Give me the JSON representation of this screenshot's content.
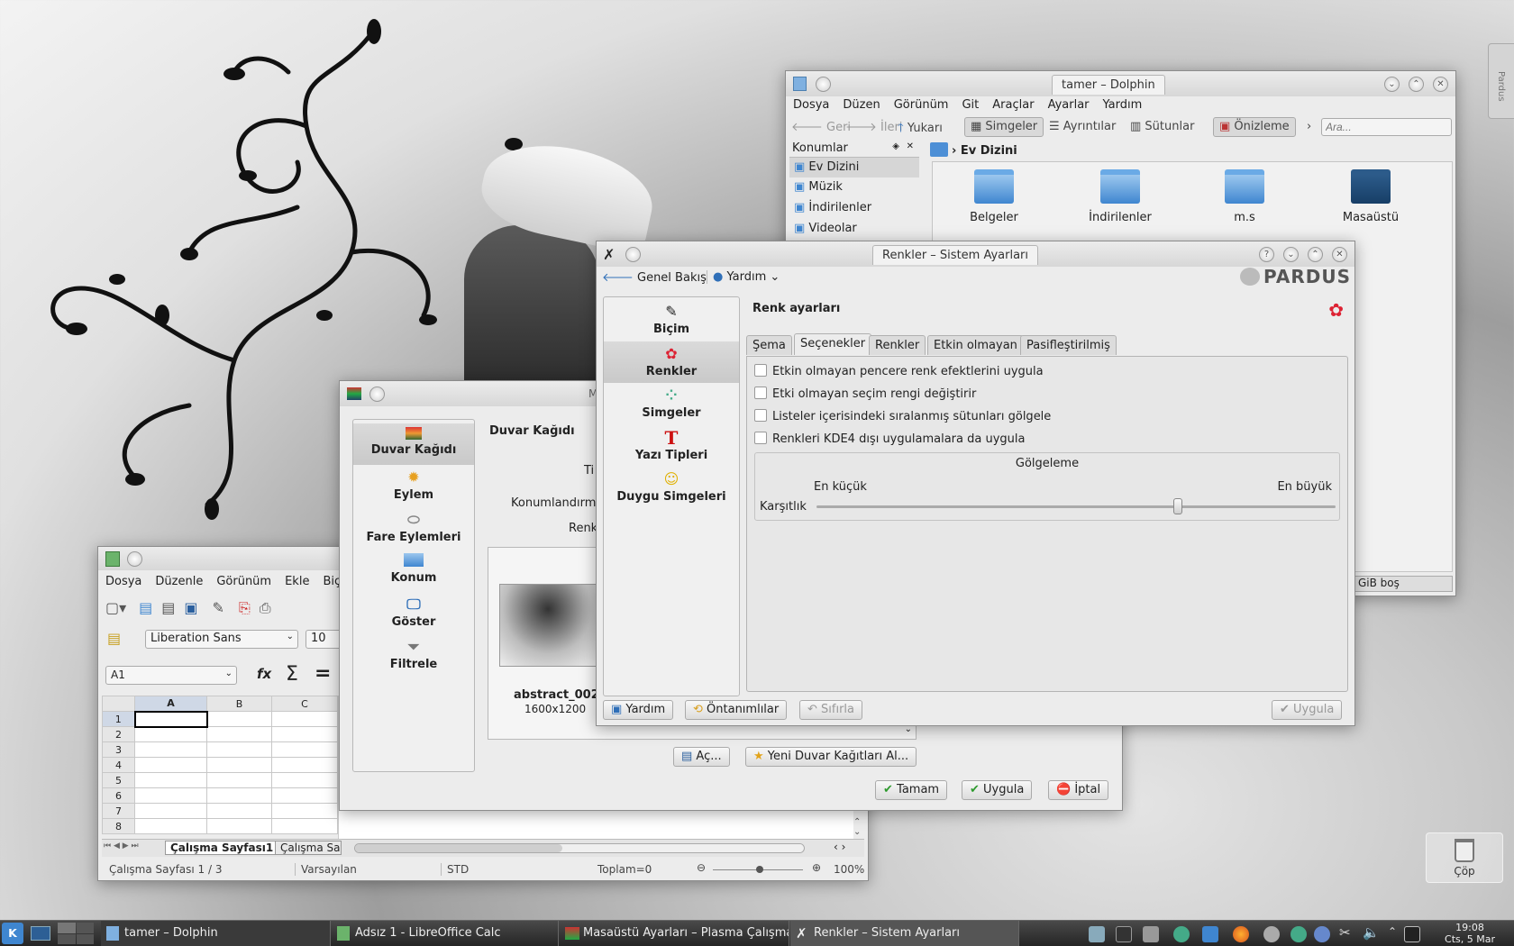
{
  "colors": {
    "accent": "#3f86d0",
    "taskbar": "#2e2e2e",
    "stop_red": "#cc2222",
    "check_green": "#2e9a2e"
  },
  "dolphin": {
    "title": "tamer – Dolphin",
    "menu": [
      "Dosya",
      "Düzen",
      "Görünüm",
      "Git",
      "Araçlar",
      "Ayarlar",
      "Yardım"
    ],
    "toolbar": {
      "back": "Geri",
      "forward": "İleri",
      "up": "Yukarı",
      "icons": "Simgeler",
      "details": "Ayrıntılar",
      "columns": "Sütunlar",
      "preview": "Önizleme",
      "search_placeholder": "Ara..."
    },
    "places_header": "Konumlar",
    "places": [
      "Ev Dizini",
      "Müzik",
      "İndirilenler",
      "Videolar"
    ],
    "breadcrumb": "Ev Dizini",
    "folders": [
      "Belgeler",
      "İndirilenler",
      "m.s",
      "Masaüstü"
    ],
    "status": "GiB boş"
  },
  "settings": {
    "title": "Renkler – Sistem Ayarları",
    "overview": "Genel Bakış",
    "help": "Yardım",
    "logo": "PARDUS",
    "heading": "Renk ayarları",
    "sidebar": [
      {
        "icon": "format-icon",
        "label": "Biçim"
      },
      {
        "icon": "colors-icon",
        "label": "Renkler"
      },
      {
        "icon": "icons-icon",
        "label": "Simgeler"
      },
      {
        "icon": "fonts-icon",
        "label": "Yazı Tipleri"
      },
      {
        "icon": "emoticons-icon",
        "label": "Duygu Simgeleri"
      }
    ],
    "tabs": [
      "Şema",
      "Seçenekler",
      "Renkler",
      "Etkin olmayan",
      "Pasifleştirilmiş"
    ],
    "options": [
      "Etkin olmayan pencere renk efektlerini uygula",
      "Etki olmayan seçim rengi değiştirir",
      "Listeler içerisindeki sıralanmış sütunları gölgele",
      "Renkleri KDE4 dışı uygulamalara da uygula"
    ],
    "shading_title": "Gölgeleme",
    "shading_min": "En küçük",
    "shading_max": "En büyük",
    "contrast_label": "Karşıtlık",
    "contrast_value": 0.7,
    "btn_help": "Yardım",
    "btn_defaults": "Öntanımlılar",
    "btn_reset": "Sıfırla",
    "btn_apply": "Uygula"
  },
  "wallpaper": {
    "title_fragment": "M",
    "sidebar": [
      {
        "icon": "wallpaper-icon",
        "label": "Duvar Kağıdı"
      },
      {
        "icon": "action-icon",
        "label": "Eylem"
      },
      {
        "icon": "mouse-icon",
        "label": "Fare Eylemleri"
      },
      {
        "icon": "location-icon",
        "label": "Konum"
      },
      {
        "icon": "display-icon",
        "label": "Göster"
      },
      {
        "icon": "filter-icon",
        "label": "Filtrele"
      }
    ],
    "heading": "Duvar Kağıdı",
    "row_labels": [
      "Ti",
      "Konumlandırma",
      "Renk"
    ],
    "thumb_name": "abstract_002",
    "thumb_size": "1600x1200",
    "btn_open": "Aç...",
    "btn_new": "Yeni Duvar Kağıtları Al...",
    "btn_ok": "Tamam",
    "btn_apply": "Uygula",
    "btn_cancel": "İptal"
  },
  "calc": {
    "menu": [
      "Dosya",
      "Düzenle",
      "Görünüm",
      "Ekle",
      "Biçim"
    ],
    "font": "Liberation Sans",
    "size": "10",
    "cell_ref": "A1",
    "columns": [
      "A",
      "B",
      "C"
    ],
    "rows": [
      "1",
      "2",
      "3",
      "4",
      "5",
      "6",
      "7",
      "8"
    ],
    "sheet_tabs": [
      "Çalışma Sayfası1",
      "Çalışma Sayf"
    ],
    "status": {
      "sheet": "Çalışma Sayfası 1 / 3",
      "style": "Varsayılan",
      "mode": "STD",
      "sum": "Toplam=0",
      "zoom": "100%"
    }
  },
  "desktop": {
    "trash": "Çöp",
    "side_tab": "Pardus"
  },
  "taskbar": {
    "items": [
      "tamer – Dolphin",
      "Adsız 1 - LibreOffice Calc",
      "Masaüstü Ayarları – Plasma Çalışma",
      "Renkler – Sistem Ayarları"
    ],
    "time": "19:08",
    "date": "Cts, 5 Mar"
  }
}
